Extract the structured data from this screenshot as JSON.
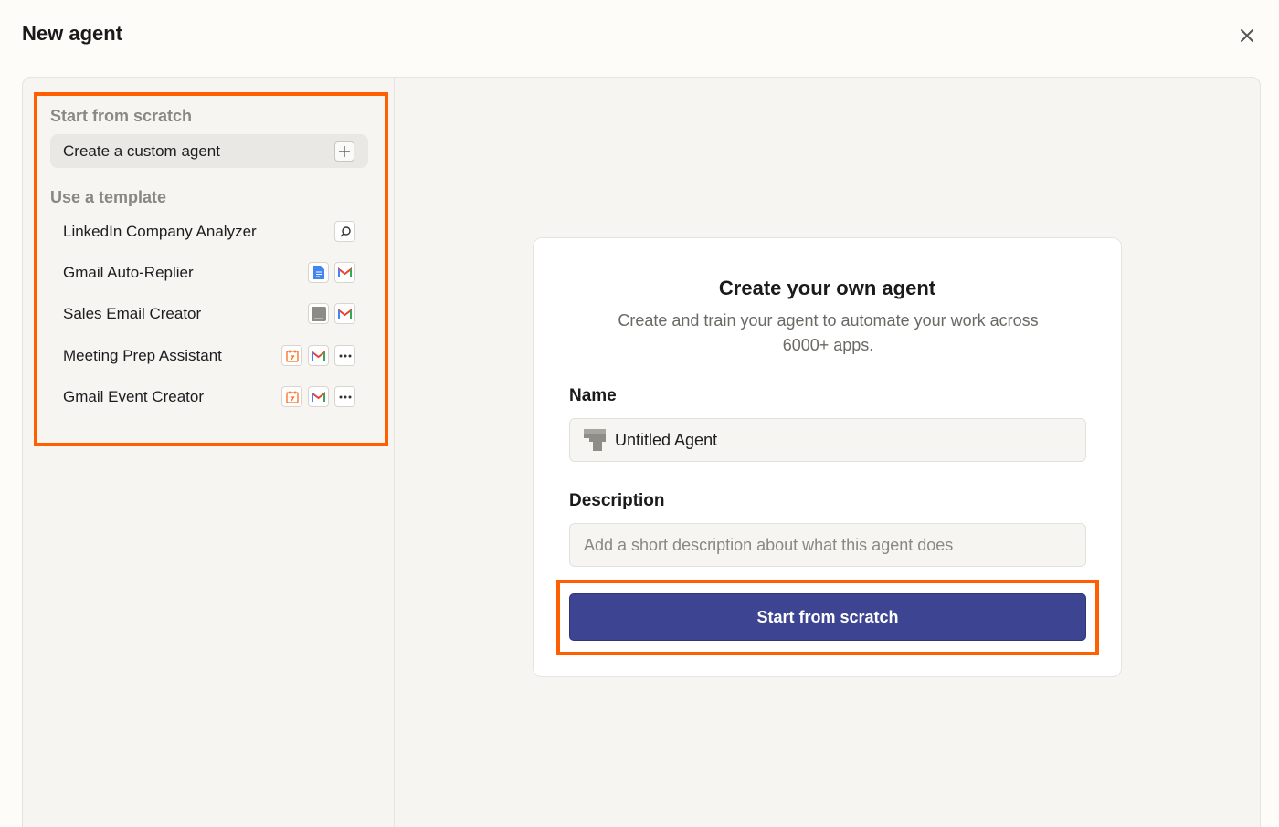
{
  "modal": {
    "title": "New agent",
    "close_icon": "close-icon"
  },
  "sidebar": {
    "scratch_section_label": "Start from scratch",
    "custom_agent_label": "Create a custom agent",
    "template_section_label": "Use a template",
    "templates": [
      {
        "label": "LinkedIn Company Analyzer",
        "icons": [
          "search-icon"
        ]
      },
      {
        "label": "Gmail Auto-Replier",
        "icons": [
          "google-docs-icon",
          "gmail-icon"
        ]
      },
      {
        "label": "Sales Email Creator",
        "icons": [
          "app-placeholder-icon",
          "gmail-icon"
        ]
      },
      {
        "label": "Meeting Prep Assistant",
        "icons": [
          "calendar-icon",
          "gmail-icon",
          "more-icon"
        ]
      },
      {
        "label": "Gmail Event Creator",
        "icons": [
          "calendar-icon",
          "gmail-icon",
          "more-icon"
        ]
      }
    ]
  },
  "card": {
    "title": "Create your own agent",
    "subtitle": "Create and train your agent to automate your work across 6000+ apps.",
    "name_label": "Name",
    "name_value": "Untitled Agent",
    "description_label": "Description",
    "description_placeholder": "Add a short description about what this agent does",
    "start_button_label": "Start from scratch"
  },
  "colors": {
    "accent": "#3d4592",
    "highlight": "#ff5f00",
    "gmail_red": "#ea4335",
    "docs_blue": "#4285f4",
    "calendar_orange": "#ff6a1a"
  }
}
